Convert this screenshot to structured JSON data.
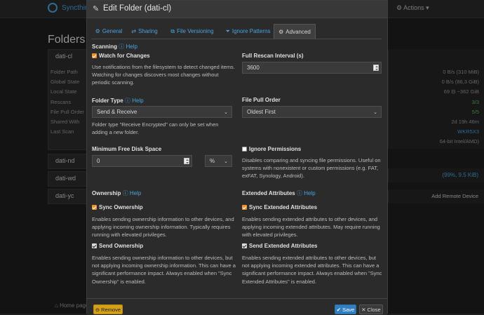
{
  "background": {
    "brand": "Syncthing",
    "actions_label": "Actions",
    "folders_title": "Folders",
    "folders": [
      "dati-cl",
      "dati-nd",
      "dati-wd",
      "dati-yc"
    ],
    "folder_info_labels": [
      "Folder Path",
      "Global State",
      "Local State",
      "Rescans",
      "File Pull Order",
      "Shared With",
      "Last Scan"
    ],
    "right_values": [
      "0 B/s (310 MiB)",
      "0 B/s (86,3 GiB)",
      "69  ⊟ ~362 GiB",
      "3/3",
      "5/5",
      "2d 19h 46m",
      "WKR5X3",
      "64-bit Intel/AMD)"
    ],
    "sync_status": "(99%, 9.5 KiB)",
    "add_remote_device": "Add Remote Device",
    "home_page": "Home page"
  },
  "modal": {
    "title": "Edit Folder (dati-cl)",
    "tabs": [
      {
        "label": "General",
        "icon": "gear"
      },
      {
        "label": "Sharing",
        "icon": "share"
      },
      {
        "label": "File Versioning",
        "icon": "files"
      },
      {
        "label": "Ignore Patterns",
        "icon": "filter"
      },
      {
        "label": "Advanced",
        "icon": "gears"
      }
    ],
    "help_label": "Help",
    "scanning": {
      "heading": "Scanning",
      "watch_label": "Watch for Changes",
      "watch_desc": "Use notifications from the filesystem to detect changed items. Watching for changes discovers most changes without periodic scanning."
    },
    "rescan": {
      "label": "Full Rescan Interval (s)",
      "value": "3600"
    },
    "folder_type": {
      "label": "Folder Type",
      "value": "Send & Receive",
      "desc": "Folder type \"Receive Encrypted\" can only be set when adding a new folder."
    },
    "pull_order": {
      "label": "File Pull Order",
      "value": "Oldest First"
    },
    "min_disk": {
      "label": "Minimum Free Disk Space",
      "value": "0",
      "unit": "%"
    },
    "ignore_perms": {
      "label": "Ignore Permissions",
      "desc": "Disables comparing and syncing file permissions. Useful on systems with nonexistent or custom permissions (e.g. FAT, exFAT, Synology, Android)."
    },
    "ownership": {
      "heading": "Ownership",
      "sync_label": "Sync Ownership",
      "sync_desc": "Enables sending ownership information to other devices, and applying incoming ownership information. Typically requires running with elevated privileges.",
      "send_label": "Send Ownership",
      "send_desc": "Enables sending ownership information to other devices, but not applying incoming ownership information. This can have a significant performance impact. Always enabled when \"Sync Ownership\" is enabled."
    },
    "xattrs": {
      "heading": "Extended Attributes",
      "sync_label": "Sync Extended Attributes",
      "sync_desc": "Enables sending extended attributes to other devices, and applying incoming extended attributes. May require running with elevated privileges.",
      "send_label": "Send Extended Attributes",
      "send_desc": "Enables sending extended attributes to other devices, but not applying incoming extended attributes. This can have a significant performance impact. Always enabled when \"Sync Extended Attributes\" is enabled."
    },
    "footer": {
      "remove": "Remove",
      "save": "Save",
      "close": "Close"
    }
  },
  "colors": {
    "accent": "#4aa3df",
    "checkbox": "#e8912e",
    "remove": "#d4a017",
    "save": "#2f7fc1"
  }
}
